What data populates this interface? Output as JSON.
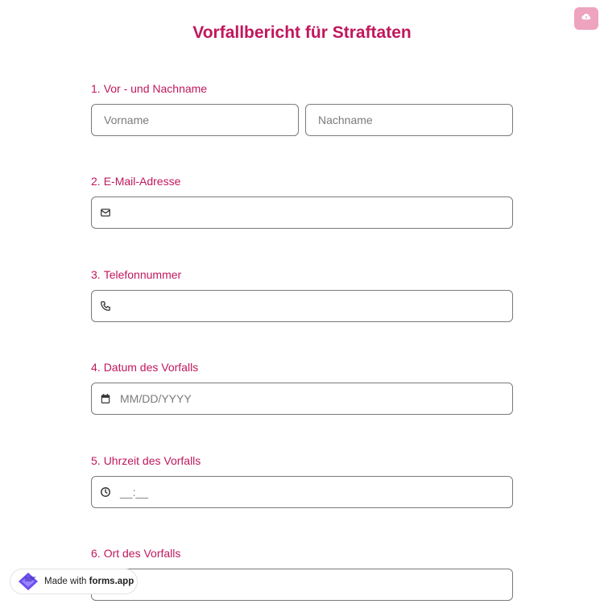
{
  "form": {
    "title": "Vorfallbericht für Straftaten"
  },
  "questions": [
    {
      "number": "1.",
      "label": "Vor - und Nachname",
      "placeholder_first": "Vorname",
      "placeholder_last": "Nachname"
    },
    {
      "number": "2.",
      "label": "E-Mail-Adresse",
      "icon": "mail-icon"
    },
    {
      "number": "3.",
      "label": "Telefonnummer",
      "icon": "phone-icon"
    },
    {
      "number": "4.",
      "label": "Datum des Vorfalls",
      "icon": "calendar-icon",
      "placeholder": "MM/DD/YYYY"
    },
    {
      "number": "5.",
      "label": "Uhrzeit des Vorfalls",
      "icon": "clock-icon",
      "placeholder": "__:__"
    },
    {
      "number": "6.",
      "label": "Ort des Vorfalls"
    }
  ],
  "badge": {
    "prefix": "Made with",
    "brand": "forms.app"
  },
  "colors": {
    "accent": "#c0175d",
    "save_button": "#eea3bf",
    "border": "#7a7a7a"
  }
}
